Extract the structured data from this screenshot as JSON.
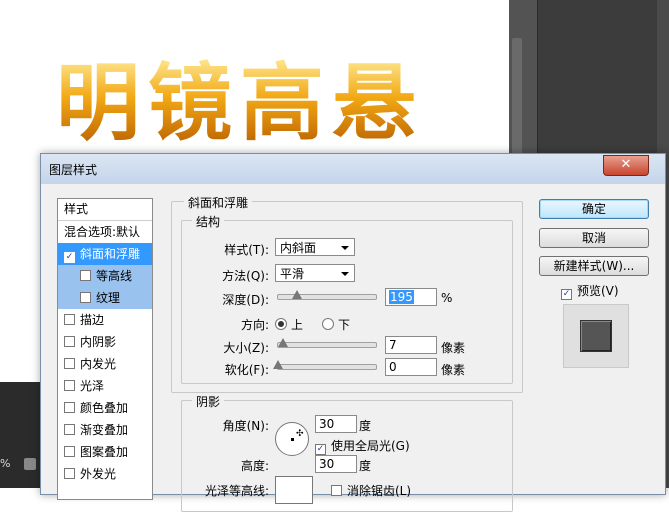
{
  "canvas": {
    "artwork_text": "明镜高悬",
    "zoom_text": "%"
  },
  "dialog": {
    "title": "图层样式",
    "close_symbol": "✕",
    "style_list": {
      "header": "样式",
      "items": [
        {
          "label": "混合选项:默认",
          "checkbox": false,
          "checked": false,
          "state": "normal"
        },
        {
          "label": "斜面和浮雕",
          "checkbox": true,
          "checked": true,
          "state": "selected"
        },
        {
          "label": "等高线",
          "checkbox": true,
          "checked": false,
          "state": "sub"
        },
        {
          "label": "纹理",
          "checkbox": true,
          "checked": false,
          "state": "sub"
        },
        {
          "label": "描边",
          "checkbox": true,
          "checked": false,
          "state": "normal"
        },
        {
          "label": "内阴影",
          "checkbox": true,
          "checked": false,
          "state": "normal"
        },
        {
          "label": "内发光",
          "checkbox": true,
          "checked": false,
          "state": "normal"
        },
        {
          "label": "光泽",
          "checkbox": true,
          "checked": false,
          "state": "normal"
        },
        {
          "label": "颜色叠加",
          "checkbox": true,
          "checked": false,
          "state": "normal"
        },
        {
          "label": "渐变叠加",
          "checkbox": true,
          "checked": false,
          "state": "normal"
        },
        {
          "label": "图案叠加",
          "checkbox": true,
          "checked": false,
          "state": "normal"
        },
        {
          "label": "外发光",
          "checkbox": true,
          "checked": false,
          "state": "normal"
        }
      ]
    },
    "bevel": {
      "group_title": "斜面和浮雕",
      "structure_title": "结构",
      "style_label": "样式(T):",
      "style_value": "内斜面",
      "technique_label": "方法(Q):",
      "technique_value": "平滑",
      "depth_label": "深度(D):",
      "depth_value": "195",
      "depth_unit": "%",
      "depth_slider": 0.19,
      "direction_label": "方向:",
      "direction_up": "上",
      "direction_down": "下",
      "direction_selected": "up",
      "size_label": "大小(Z):",
      "size_value": "7",
      "size_unit": "像素",
      "size_slider": 0.05,
      "soften_label": "软化(F):",
      "soften_value": "0",
      "soften_unit": "像素",
      "soften_slider": 0.0
    },
    "shading": {
      "group_title": "阴影",
      "angle_label": "角度(N):",
      "angle_value": "30",
      "angle_unit": "度",
      "global_light_label": "使用全局光(G)",
      "global_light_checked": true,
      "altitude_label": "高度:",
      "altitude_value": "30",
      "altitude_unit": "度",
      "gloss_contour_label": "光泽等高线:",
      "anti_alias_label": "消除锯齿(L)"
    },
    "buttons": {
      "ok": "确定",
      "cancel": "取消",
      "new_style": "新建样式(W)...",
      "preview_label": "预览(V)",
      "preview_checked": true
    }
  }
}
